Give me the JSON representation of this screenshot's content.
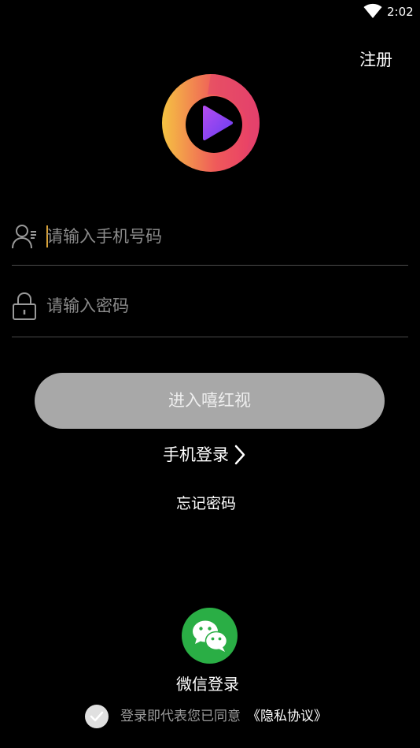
{
  "status_bar": {
    "time": "2:02",
    "wifi_icon": "wifi-icon"
  },
  "header": {
    "register_label": "注册"
  },
  "logo": {
    "icon": "play-logo-icon",
    "colors": {
      "ring_start": "#f5c342",
      "ring_end": "#e83a6b",
      "play_start": "#b14cf0",
      "play_end": "#6a3ef0"
    }
  },
  "form": {
    "phone": {
      "icon": "user-icon",
      "value": "",
      "placeholder": "请输入手机号码"
    },
    "password": {
      "icon": "lock-icon",
      "value": "",
      "placeholder": "请输入密码"
    },
    "submit_label": "进入嘻红视"
  },
  "links": {
    "phone_login_label": "手机登录",
    "phone_login_icon": "chevron-right-icon",
    "forgot_password_label": "忘记密码"
  },
  "social": {
    "wechat_icon": "wechat-icon",
    "wechat_label": "微信登录",
    "wechat_color": "#2aae45"
  },
  "agreement": {
    "check_icon": "check-icon",
    "text": "登录即代表您已同意",
    "privacy_label": "《隐私协议》"
  }
}
